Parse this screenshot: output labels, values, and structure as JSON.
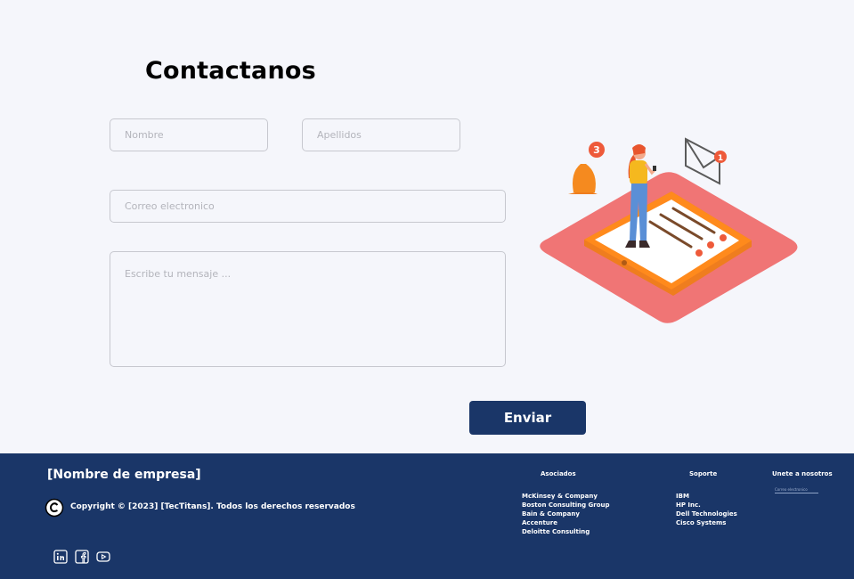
{
  "contact": {
    "title": "Contactanos",
    "first_name_placeholder": "Nombre",
    "last_name_placeholder": "Apellidos",
    "email_placeholder": "Correo electronico",
    "message_placeholder": "Escribe tu mensaje ...",
    "send_label": "Enviar"
  },
  "illustration": {
    "bell_badge": "3",
    "mail_badge": "1"
  },
  "footer": {
    "company_name": "[Nombre de empresa]",
    "copyright": "Copyright © [2023] [TecTitans]. Todos los derechos reservados",
    "associates": {
      "title": "Asociados",
      "items": [
        "McKinsey & Company",
        "Boston Consulting Group",
        "Bain & Company",
        "Accenture",
        "Deloitte Consulting"
      ]
    },
    "support": {
      "title": "Soporte",
      "items": [
        "IBM",
        "HP Inc.",
        "Dell Technologies",
        "Cisco Systems"
      ]
    },
    "join": {
      "title": "Unete a nosotros",
      "email_placeholder": "Correo electronico"
    },
    "social": [
      "linkedin-icon",
      "facebook-icon",
      "youtube-icon"
    ]
  },
  "colors": {
    "primary": "#1a3668",
    "background": "#f5f6fb",
    "accent_orange": "#f5821f",
    "accent_red": "#ee5a3a",
    "platform_pink": "#f07575"
  }
}
